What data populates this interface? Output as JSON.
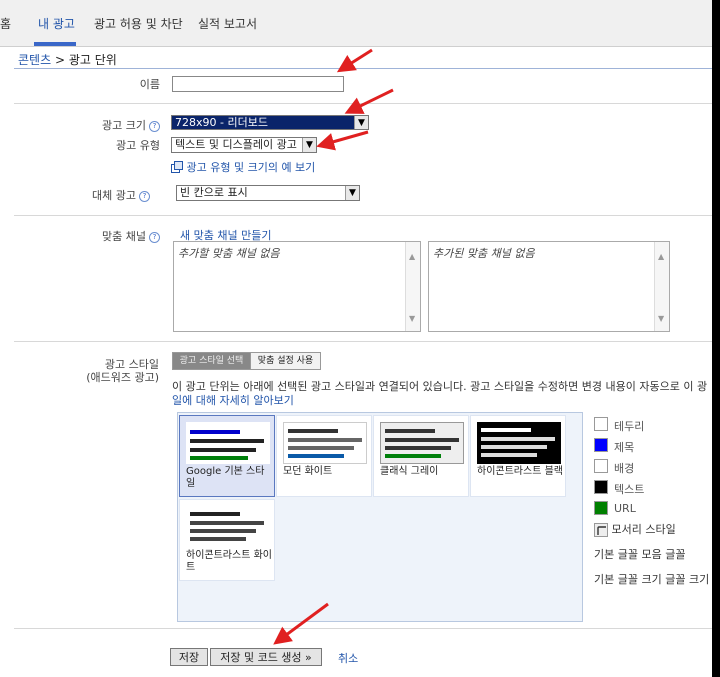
{
  "tabs": [
    {
      "label": "홈"
    },
    {
      "label": "내 광고"
    },
    {
      "label": "광고 허용 및 차단"
    },
    {
      "label": "실적 보고서"
    }
  ],
  "breadcrumb": {
    "link": "콘텐츠",
    "separator": ">",
    "current": "광고 단위"
  },
  "form": {
    "name_label": "이름",
    "name_value": "",
    "size_label": "광고 크기",
    "size_value": "728x90 - 리더보드",
    "type_label": "광고 유형",
    "type_value": "텍스트 및 디스플레이 광고",
    "examples_link": "광고 유형 및 크기의 예 보기",
    "backup_label": "대체 광고",
    "backup_value": "빈 칸으로 표시",
    "channels_label": "맞춤 채널",
    "new_channel_link": "새 맞춤 채널 만들기",
    "channels_available": "추가할 맞춤 채널 없음",
    "channels_added": "추가된 맞춤 채널 없음",
    "style_label_1": "광고 스타일",
    "style_label_2": "(애드워즈 광고)",
    "style_tab_select": "광고 스타일 선택",
    "style_tab_custom": "맞춤 설정 사용",
    "style_desc_1": "이 광고 단위는 아래에 선택된 광고 스타일과 연결되어 있습니다. 광고 스타일을 수정하면 변경 내용이 자동으로 이 광",
    "style_desc_2": "일에 대해 자세히 알아보기",
    "help_symbol": "?"
  },
  "styles": [
    {
      "label": "Google 기본 스타일",
      "selected": true
    },
    {
      "label": "모던 화이트"
    },
    {
      "label": "클래식 그레이"
    },
    {
      "label": "하이콘트라스트 블랙"
    },
    {
      "label": "하이콘트라스트 화이트"
    }
  ],
  "colors": [
    {
      "label": "테두리",
      "color": "#ffffff"
    },
    {
      "label": "제목",
      "color": "#0000ff"
    },
    {
      "label": "배경",
      "color": "#ffffff"
    },
    {
      "label": "텍스트",
      "color": "#000000"
    },
    {
      "label": "URL",
      "color": "#008000"
    }
  ],
  "corner_style": "모서리 스타일",
  "font_family": "기본 글꼴 모음 글꼴",
  "font_size": "기본 글꼴 크기 글꼴 크기",
  "buttons": {
    "save": "저장",
    "save_code": "저장 및 코드 생성 »",
    "cancel": "취소"
  },
  "accent": "#2255aa"
}
